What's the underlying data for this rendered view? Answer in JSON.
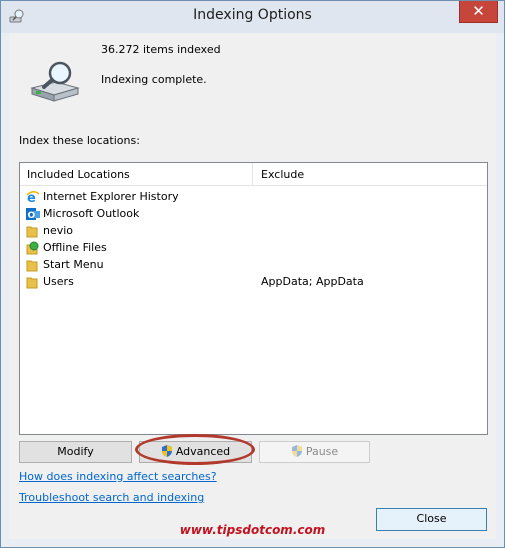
{
  "window": {
    "title": "Indexing Options",
    "close_glyph": "✕"
  },
  "status": {
    "items_indexed": "36.272 items indexed",
    "message": "Indexing complete."
  },
  "locations": {
    "label": "Index these locations:",
    "headers": {
      "included": "Included Locations",
      "exclude": "Exclude"
    },
    "rows": [
      {
        "name": "Internet Explorer History",
        "exclude": "",
        "icon": "ie-icon"
      },
      {
        "name": "Microsoft Outlook",
        "exclude": "",
        "icon": "outlook-icon"
      },
      {
        "name": "nevio",
        "exclude": "",
        "icon": "folder-icon"
      },
      {
        "name": "Offline Files",
        "exclude": "",
        "icon": "offline-files-icon"
      },
      {
        "name": "Start Menu",
        "exclude": "",
        "icon": "folder-icon"
      },
      {
        "name": "Users",
        "exclude": "AppData; AppData",
        "icon": "folder-icon"
      }
    ]
  },
  "buttons": {
    "modify": "Modify",
    "advanced": "Advanced",
    "pause": "Pause",
    "close": "Close"
  },
  "links": {
    "how_indexing": "How does indexing affect searches?",
    "troubleshoot": "Troubleshoot search and indexing"
  },
  "watermark": "www.tipsdotcom.com",
  "colors": {
    "accent": "#0066cc",
    "highlight": "#b23a2c",
    "close_red": "#c7463b"
  }
}
